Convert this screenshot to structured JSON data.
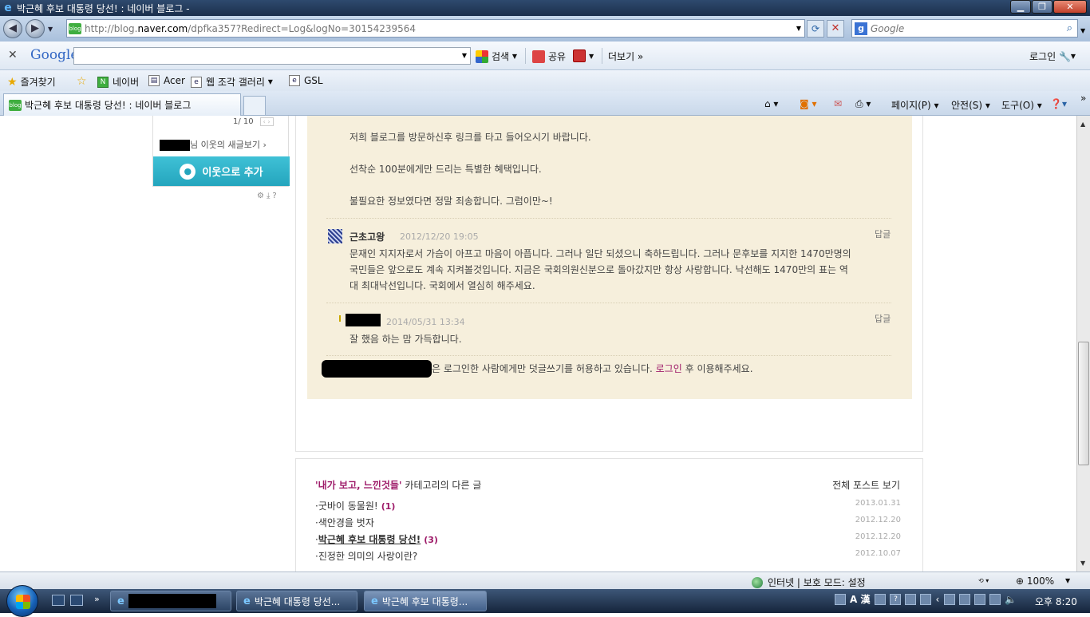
{
  "window": {
    "title": "박근혜 후보 대통령 당선! : 네이버 블로그 -",
    "minimize": "▁",
    "restore": "❐",
    "close": "✕"
  },
  "address": {
    "url_prefix": "http://blog.",
    "url_host": "naver.com",
    "url_path": "/dpfka357?Redirect=Log&logNo=30154239564",
    "search_placeholder": "Google"
  },
  "google_toolbar": {
    "logo": "Google",
    "search_label": "검색",
    "share_label": "공유",
    "more_label": "더보기 »",
    "login_label": "로그인"
  },
  "favorites": {
    "label": "즐겨찾기",
    "items": [
      {
        "label": "네이버"
      },
      {
        "label": "Acer"
      },
      {
        "label": "웹 조각 갤러리"
      },
      {
        "label": "GSL"
      }
    ]
  },
  "tab": {
    "label": "박근혜 후보 대통령 당선! : 네이버 블로그"
  },
  "commands": {
    "page": "페이지(P)",
    "safety": "안전(S)",
    "tools": "도구(O)"
  },
  "sidebar": {
    "pager": "1/ 10",
    "new_posts": "님 이웃의 새글보기 ›",
    "add_neighbor": "이웃으로 추가"
  },
  "comments": {
    "intro_lines": [
      "저희 블로그를 방문하신후 링크를 타고 들어오시기 바랍니다.",
      "선착순 100분에게만 드리는 특별한 혜택입니다.",
      "불필요한 정보였다면 정말 죄송합니다. 그럼이만~!"
    ],
    "reply_label": "답글",
    "c1_author": "근초고왕",
    "c1_date": "2012/12/20 19:05",
    "c1_lines": [
      "문재인 지지자로서 가슴이 아프고 마음이 아픕니다. 그러나 일단 되셨으니 축하드립니다. 그러나 문후보를 지지한 1470만명의",
      "국민들은 앞으로도 계속 지켜볼것입니다. 지금은 국회의원신분으로 돌아갔지만 항상 사랑합니다. 낙선해도 1470만의 표는 역",
      "대 최대낙선입니다. 국회에서 열심히 해주세요."
    ],
    "c2_date": "2014/05/31 13:34",
    "c2_text": "잘 했음 하는 맘 가득합니다.",
    "login_notice_pre": "은 로그인한 사람에게만 덧글쓰기를 허용하고 있습니다.",
    "login_link": "로그인",
    "login_notice_post": "후 이용해주세요."
  },
  "related": {
    "category": "'내가 보고, 느낀것들'",
    "title_suffix": "카테고리의 다른 글",
    "all_posts": "전체 포스트 보기",
    "posts": [
      {
        "title": "굿바이 동물원!",
        "count": "(1)",
        "date": "2013.01.31"
      },
      {
        "title": "색안경을 벗자",
        "count": "",
        "date": "2012.12.20"
      },
      {
        "title": "박근혜 후보 대통령 당선!",
        "count": "(3)",
        "date": "2012.12.20"
      },
      {
        "title": "진정한 의미의 사랑이란?",
        "count": "",
        "date": "2012.10.07"
      }
    ]
  },
  "status": {
    "zone": "인터넷 | 보호 모드: 설정",
    "zoom": "100%"
  },
  "taskbar": {
    "items": [
      {
        "label": "박근혜 대통령 당선..."
      },
      {
        "label": "박근혜 후보 대통령..."
      }
    ],
    "tray_ime": "A 漢",
    "clock": "오후 8:20"
  }
}
